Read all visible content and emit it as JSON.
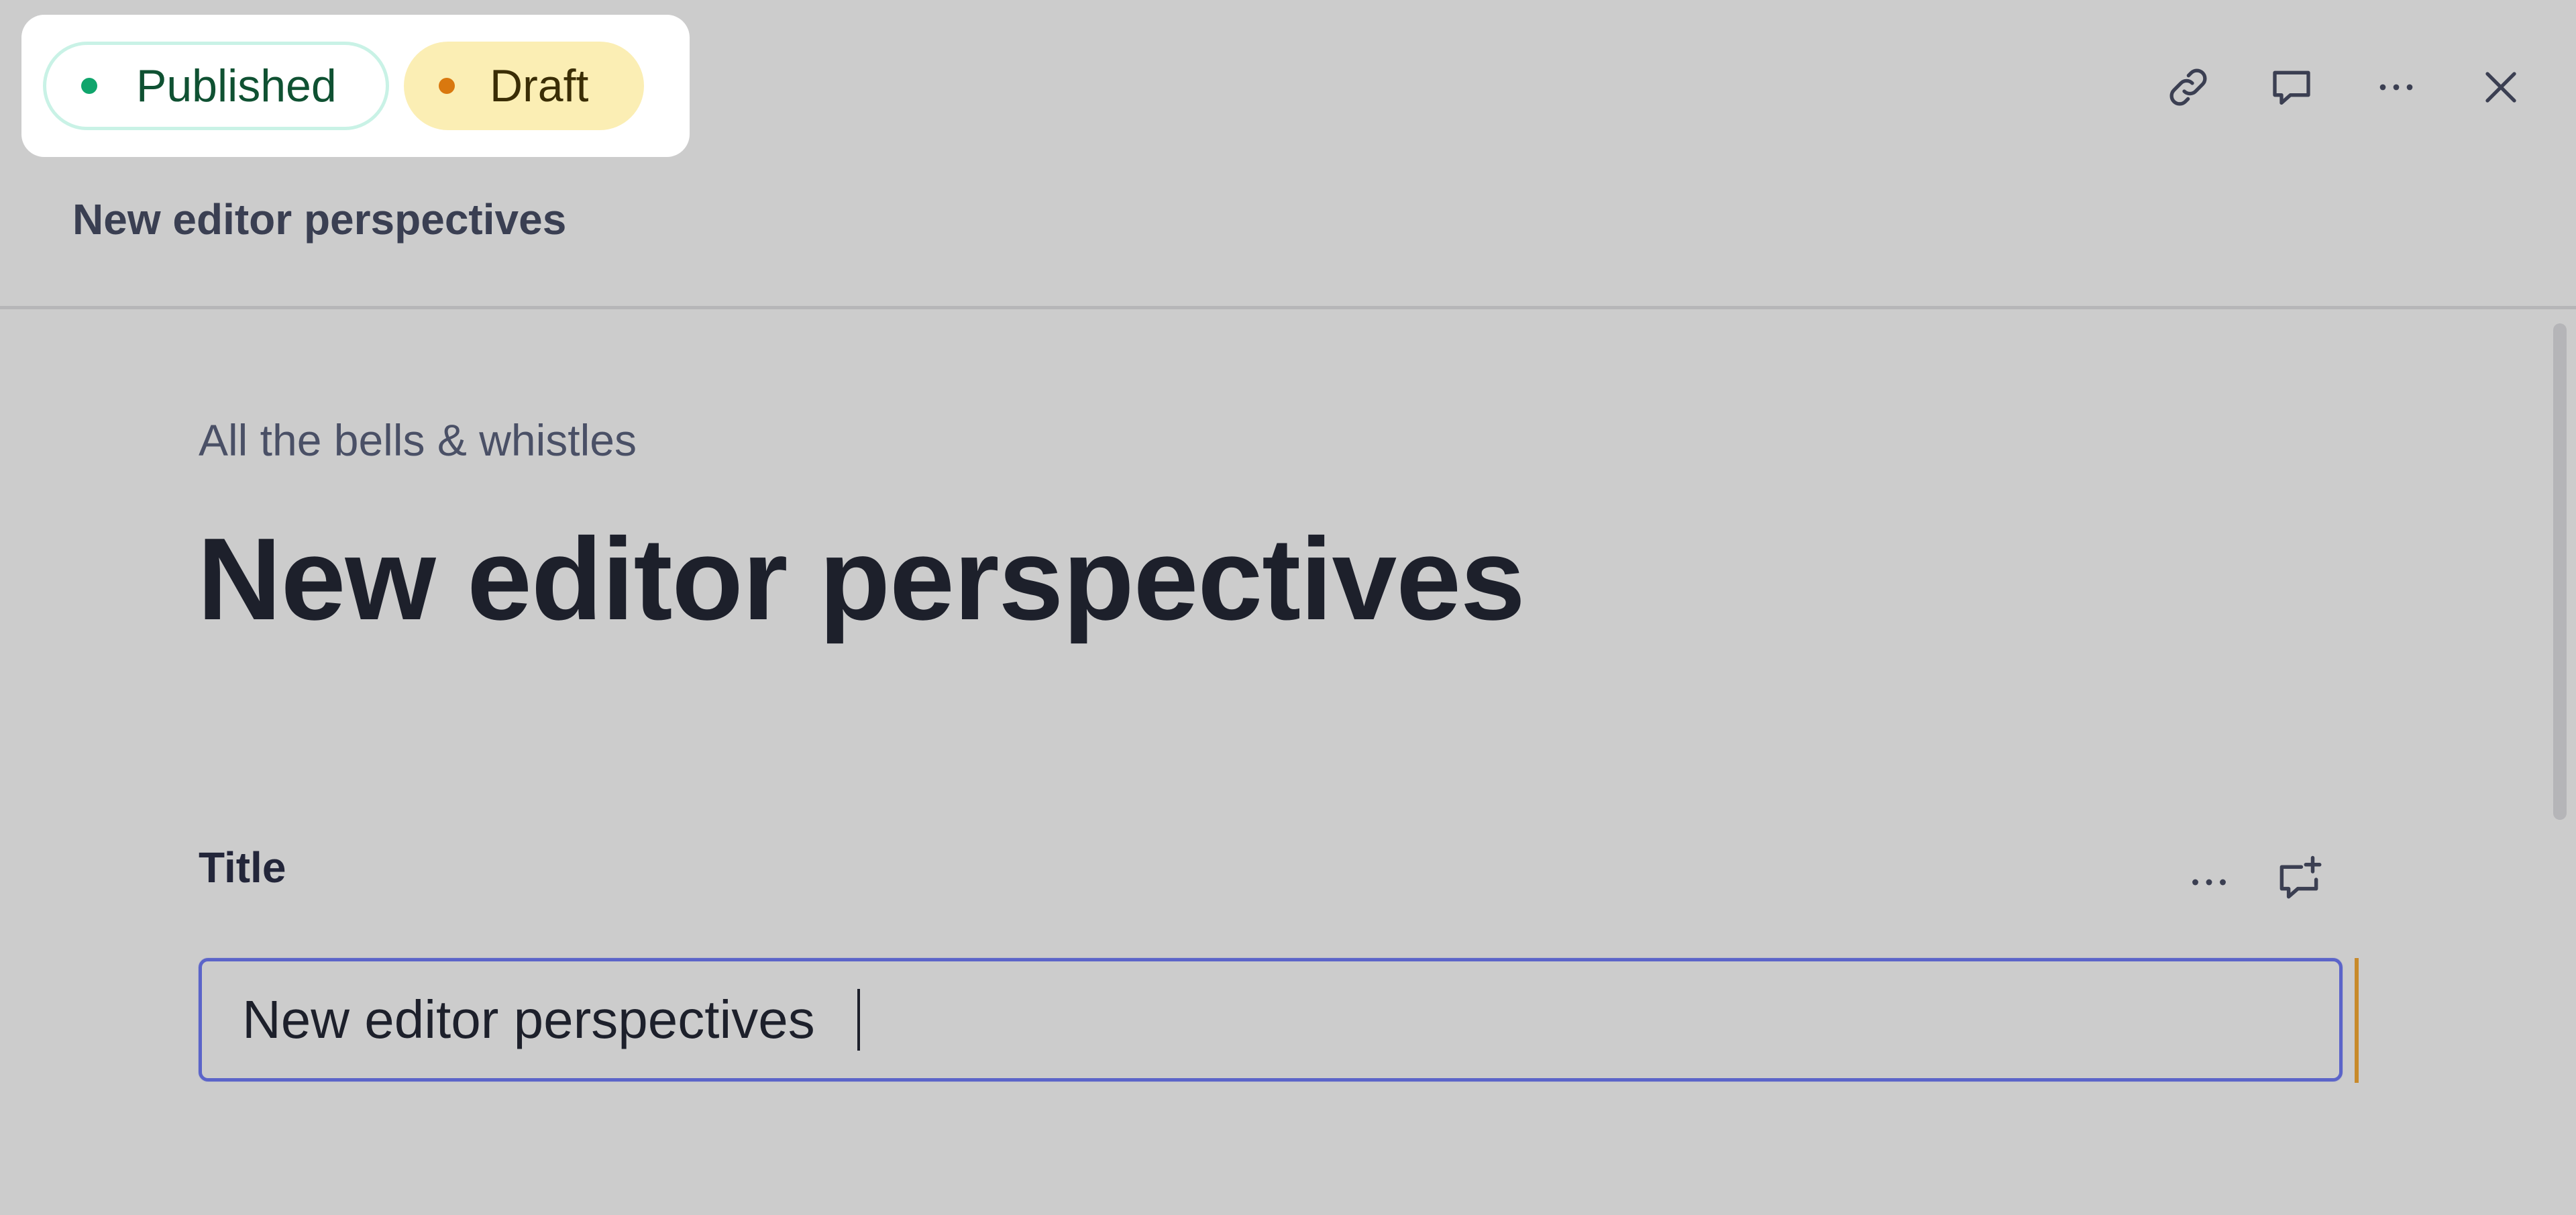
{
  "perspectives": {
    "published": {
      "label": "Published",
      "dot_color": "#10a56c"
    },
    "draft": {
      "label": "Draft",
      "dot_color": "#d9780f"
    }
  },
  "header": {
    "document_title": "New editor perspectives",
    "actions": [
      "link-icon",
      "comment-icon",
      "more-icon",
      "close-icon"
    ]
  },
  "document": {
    "subtitle": "All the bells & whistles",
    "title": "New editor perspectives"
  },
  "fields": [
    {
      "label": "Title",
      "value": "New editor perspectives",
      "actions": [
        "more-icon",
        "add-comment-icon"
      ]
    }
  ],
  "colors": {
    "background": "#cccccc",
    "focus_border": "#5b64c9",
    "change_indicator": "#c88a2a"
  }
}
